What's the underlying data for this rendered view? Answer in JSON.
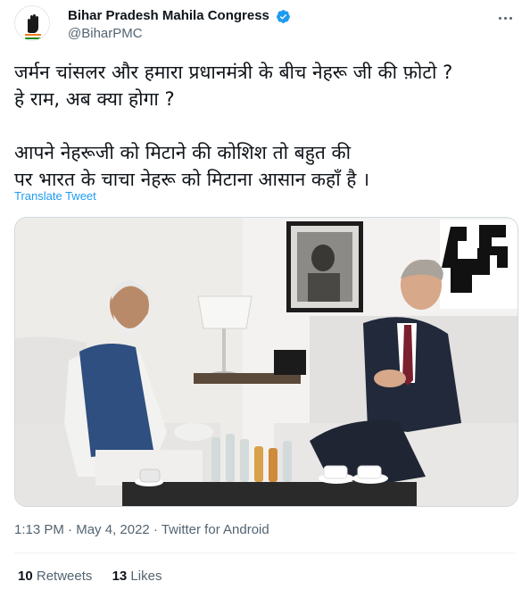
{
  "author": {
    "display_name": "Bihar Pradesh Mahila Congress",
    "handle": "@BiharPMC",
    "verified": true,
    "avatar_icon": "congress-hand-logo-icon"
  },
  "tweet": {
    "text": "जर्मन चांसलर और हमारा प्रधानमंत्री के बीच नेहरू जी की फ़ोटो ?\nहे राम, अब क्या होगा ?\n\nआपने नेहरूजी को मिटाने की कोशिश तो बहुत की\nपर भारत के चाचा नेहरू को मिटाना आसान कहाँ है ।",
    "translate_label": "Translate Tweet"
  },
  "meta": {
    "time": "1:13 PM",
    "sep1": " · ",
    "date": "May 4, 2022",
    "sep2": " · ",
    "source": "Twitter for Android"
  },
  "stats": {
    "retweets_count": "10",
    "retweets_label": "Retweets",
    "likes_count": "13",
    "likes_label": "Likes"
  },
  "colors": {
    "accent": "#1d9bf0",
    "text": "#0f1419",
    "secondary": "#536471"
  }
}
